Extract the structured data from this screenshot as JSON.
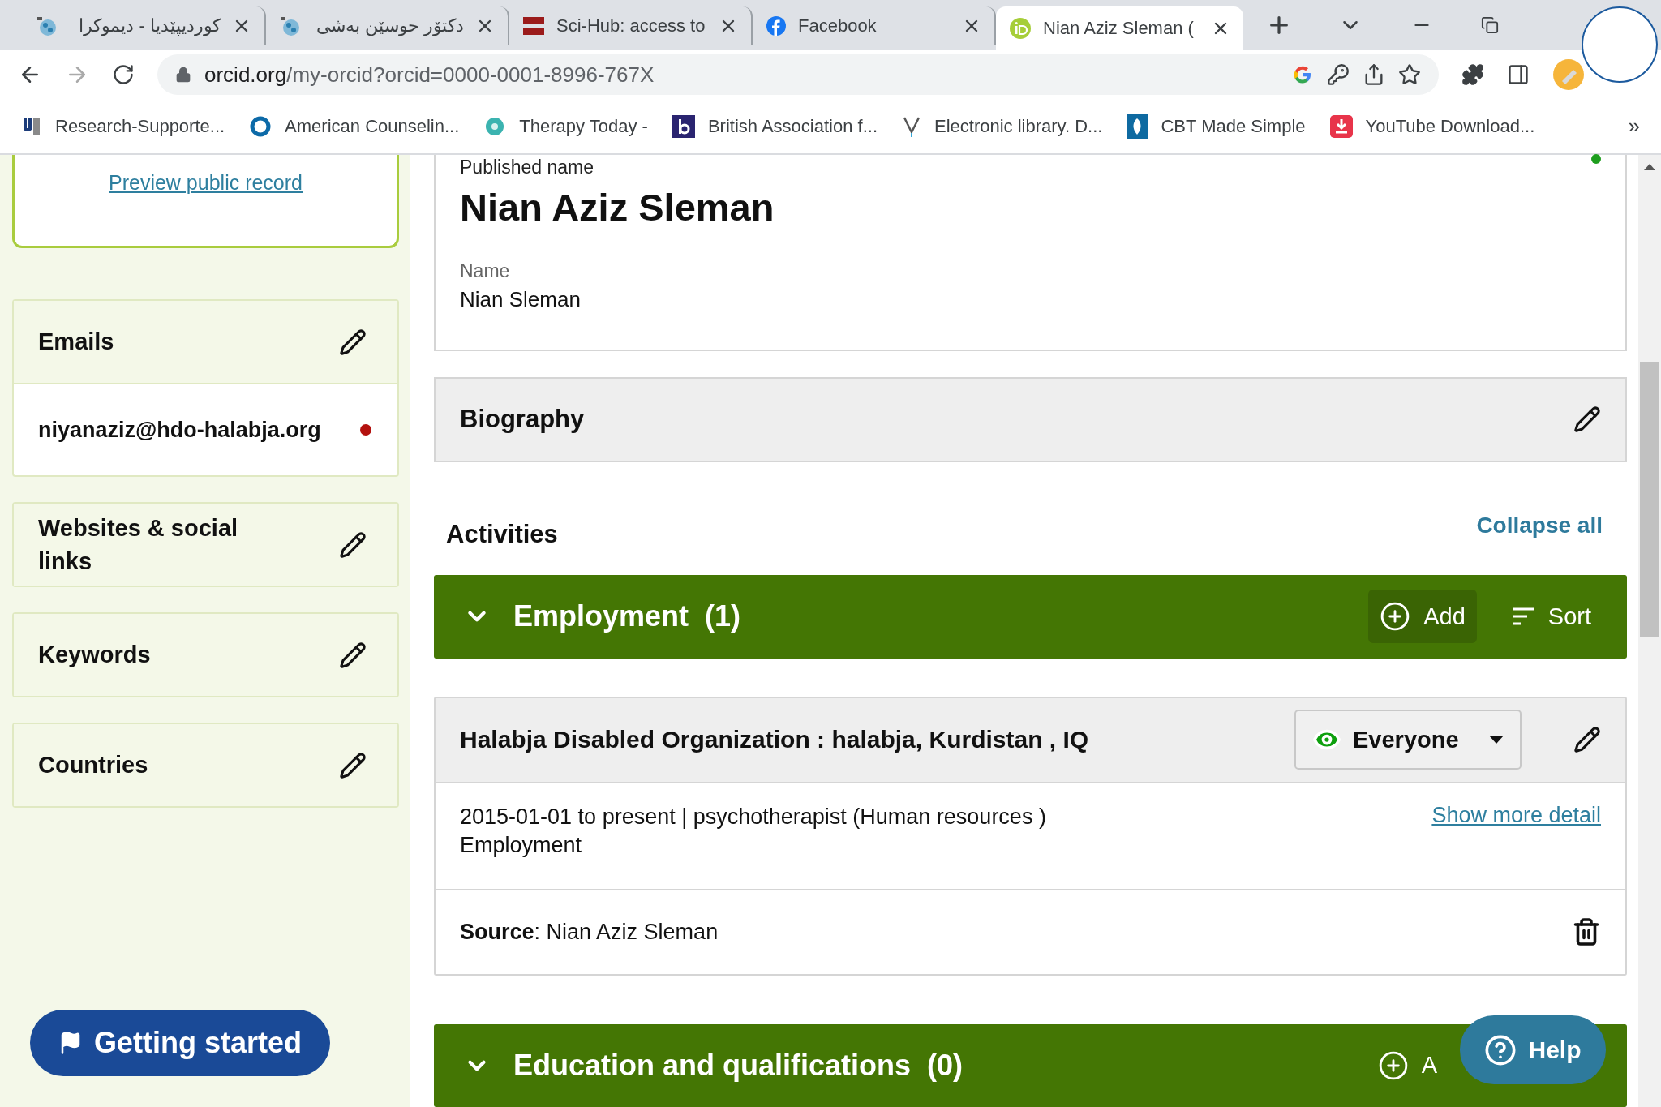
{
  "browser": {
    "tabs": [
      {
        "title": "کوردیپێدیا - دیموکرا",
        "kind": "globe",
        "selected": false
      },
      {
        "title": "دکتۆر حوسێن بەشی",
        "kind": "globe",
        "selected": false
      },
      {
        "title": "Sci-Hub: access to",
        "kind": "scihub",
        "selected": false
      },
      {
        "title": "Facebook",
        "kind": "facebook",
        "selected": false
      },
      {
        "title": "Nian Aziz Sleman (",
        "kind": "orcid",
        "selected": true
      }
    ],
    "address": {
      "host": "orcid.org",
      "path": "/my-orcid?orcid=0000-0001-8996-767X"
    },
    "bookmarks": [
      {
        "title": "Research-Supporte...",
        "kind": "research"
      },
      {
        "title": "American Counselin...",
        "kind": "ring"
      },
      {
        "title": "Therapy Today -",
        "kind": "flower"
      },
      {
        "title": "British Association f...",
        "kind": "square"
      },
      {
        "title": "Electronic library. D...",
        "kind": "vee"
      },
      {
        "title": "CBT Made Simple",
        "kind": "leaf"
      },
      {
        "title": "YouTube Download...",
        "kind": "download"
      }
    ],
    "bookmarks_overflow": "»"
  },
  "sidebar": {
    "preview_link": "Preview public record",
    "sections": [
      {
        "title": "Emails",
        "items": [
          {
            "text": "niyanaziz@hdo-halabja.org",
            "color": "#b3110e"
          }
        ]
      },
      {
        "title": "Websites & social links"
      },
      {
        "title": "Keywords"
      },
      {
        "title": "Countries"
      }
    ],
    "getting_started": "Getting started"
  },
  "main": {
    "name_card": {
      "color": "#1e9e1e",
      "published_label": "Published name",
      "published_name": "Nian Aziz Sleman",
      "name_label": "Name",
      "name": "Nian Sleman"
    },
    "biography": "Biography",
    "activities": {
      "title": "Activities",
      "collapse_all": "Collapse all",
      "sections": [
        {
          "title": "Employment",
          "count": "(1)",
          "expanded": true,
          "add": "Add",
          "sort": "Sort",
          "items": [
            {
              "title": "Halabja Disabled Organization : halabja, Kurdistan , IQ",
              "visibility": "Everyone",
              "summary": "2015-01-01 to present | psychotherapist (Human resources )",
              "type": "Employment",
              "more_link": "Show more detail",
              "source": "**Source**: Nian Aziz Sleman"
            }
          ]
        },
        {
          "title": "Education and qualifications",
          "count": "(0)",
          "expanded": true,
          "add": "A"
        }
      ]
    }
  },
  "help": "Help"
}
